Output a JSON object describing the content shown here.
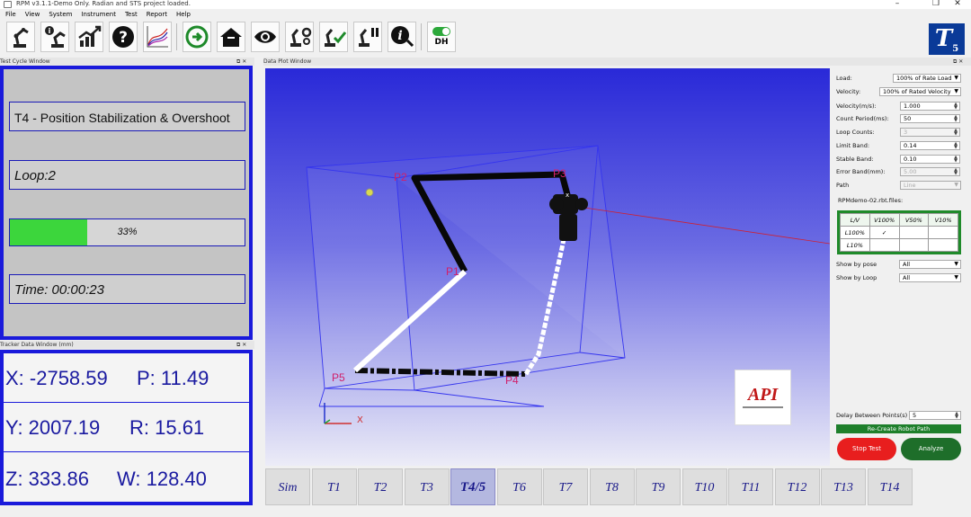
{
  "window": {
    "title": "RPM v3.1.1-Demo Only. Radian and STS  project loaded."
  },
  "menu": [
    "File",
    "View",
    "System",
    "Instrument",
    "Test",
    "Report",
    "Help"
  ],
  "toolbar": {
    "buttons": [
      "robot-arm-icon",
      "robot-info-icon",
      "trend-chart-icon",
      "help-icon",
      "graph-icon",
      "connect-power-icon",
      "home-icon",
      "eye-icon",
      "robot-settings-icon",
      "robot-check-icon",
      "robot-pause-icon",
      "info-icon",
      "dh-toggle-icon"
    ],
    "dh_label": "DH",
    "logo_letter": "T",
    "logo_sub": "5"
  },
  "test_cycle": {
    "panel_title": "Test Cycle Window",
    "test_name": "T4 - Position Stabilization & Overshoot",
    "loop": "Loop:2",
    "progress_label": "33%",
    "progress_value": 0.33,
    "time": "Time: 00:00:23",
    "progress_color": "#3cd63c"
  },
  "tracker": {
    "panel_title": "Tracker Data Window (mm)",
    "rows": [
      {
        "a": "X: -2758.59",
        "b": "P: 11.49"
      },
      {
        "a": "Y: 2007.19",
        "b": "R: 15.61"
      },
      {
        "a": "Z: 333.86",
        "b": "W: 128.40"
      }
    ]
  },
  "plot": {
    "panel_title": "Data Plot Window",
    "points": [
      "P1",
      "P2",
      "P3",
      "P4",
      "P5"
    ],
    "axis_label": "X"
  },
  "controls": {
    "load_label": "Load:",
    "load_value": "100% of Rate Load",
    "velocity_label": "Velocity:",
    "velocity_value": "100% of Rated Velocity",
    "fields": [
      {
        "label": "Velocity(m/s):",
        "value": "1.000",
        "enabled": true
      },
      {
        "label": "Count Period(ms):",
        "value": "50",
        "enabled": true
      },
      {
        "label": "Loop Counts:",
        "value": "3",
        "enabled": false
      },
      {
        "label": "Limit Band:",
        "value": "0.14",
        "enabled": true
      },
      {
        "label": "Stable Band:",
        "value": "0.10",
        "enabled": true
      },
      {
        "label": "Error Band(mm):",
        "value": "5.00",
        "enabled": false
      }
    ],
    "path_label": "Path",
    "path_value": "Line",
    "files_label": "RPMdemo-02.rbt.files:",
    "table": {
      "header": [
        "L/V",
        "V100%",
        "V50%",
        "V10%"
      ],
      "rows": [
        [
          "L100%",
          "✓",
          "",
          ""
        ],
        [
          "L10%",
          "",
          "",
          ""
        ]
      ]
    },
    "show_pose_label": "Show by pose",
    "show_pose_value": "All",
    "show_loop_label": "Show by Loop",
    "show_loop_value": "All",
    "delay_label": "Delay Between Points(s)",
    "delay_value": "5",
    "recreate_label": "Re-Create Robot Path",
    "stop_label": "Stop Test",
    "analyze_label": "Analyze",
    "stop_color": "#e81e1e",
    "analyze_color": "#1e6e2a"
  },
  "tabs": [
    "Sim",
    "T1",
    "T2",
    "T3",
    "T4/5",
    "T6",
    "T7",
    "T8",
    "T9",
    "T10",
    "T11",
    "T12",
    "T13",
    "T14"
  ],
  "active_tab": "T4/5",
  "api_logo": "API"
}
